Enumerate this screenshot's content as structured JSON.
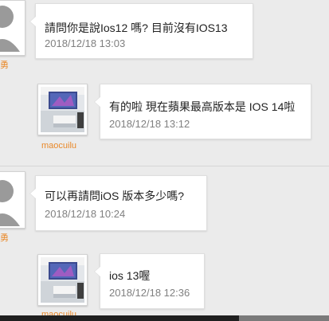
{
  "thread": [
    {
      "user": "勇",
      "message": "請問你是說Ios12 嗎?  目前沒有IOS13",
      "timestamp": "2018/12/18 13:03",
      "avatar": "default-user-icon"
    },
    {
      "user": "maocuilu",
      "message": "有的啦 現在蘋果最高版本是 IOS 14啦",
      "timestamp": "2018/12/18 13:12",
      "avatar": "room-photo"
    },
    {
      "user": "勇",
      "message": "可以再請問iOS 版本多少嗎?",
      "timestamp": "2018/12/18 10:24",
      "avatar": "default-user-icon"
    },
    {
      "user": "maocuilu",
      "message": "ios 13喔",
      "timestamp": "2018/12/18 12:36",
      "avatar": "room-photo"
    }
  ],
  "colors": {
    "background": "#ebebeb",
    "username": "#e9892a",
    "timestamp": "#808080",
    "message": "#222222",
    "bubble": "#ffffff"
  }
}
